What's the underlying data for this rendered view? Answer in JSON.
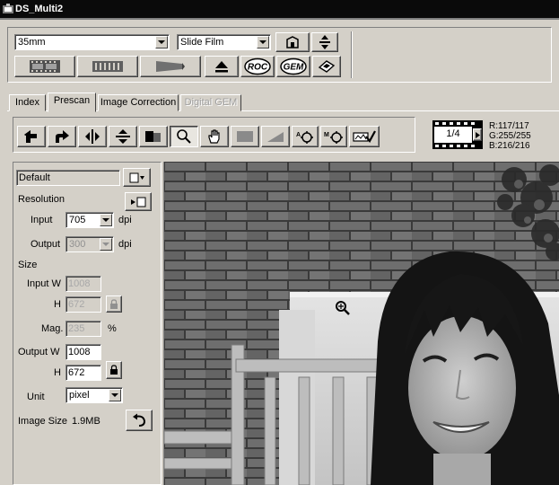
{
  "window": {
    "title": "DS_Multi2"
  },
  "toolbar": {
    "film_size": "35mm",
    "film_type": "Slide Film",
    "icons": [
      "film-strip-icon",
      "film-holder-icon",
      "slide-mount-icon",
      "eject-icon",
      "roc-icon",
      "gem-icon",
      "book-icon",
      "preferences-icon",
      "scan-adjust-icon"
    ],
    "roc_label": "ROC",
    "gem_label": "GEM"
  },
  "tabs": [
    {
      "label": "Index",
      "state": "normal"
    },
    {
      "label": "Prescan",
      "state": "active"
    },
    {
      "label": "Image Correction",
      "state": "normal"
    },
    {
      "label": "Digital GEM",
      "state": "disabled"
    }
  ],
  "tools": {
    "icons": [
      "rotate-left-icon",
      "rotate-right-icon",
      "flip-horizontal-icon",
      "flip-vertical-icon",
      "crop-icon",
      "zoom-icon",
      "hand-icon",
      "gray-swatch-icon",
      "gradient-icon",
      "white-point-icon",
      "midtone-point-icon",
      "apply-icon"
    ],
    "frame_counter": "1/4"
  },
  "rgb": {
    "r": "R:117/117",
    "g": "G:255/255",
    "b": "B:216/216"
  },
  "settings": {
    "preset": "Default",
    "resolution_label": "Resolution",
    "input_label": "Input",
    "input_value": "705",
    "input_unit": "dpi",
    "output_label": "Output",
    "output_value": "300",
    "output_unit": "dpi",
    "size_label": "Size",
    "input_w_label": "Input W",
    "input_w_value": "1008",
    "input_h_label": "H",
    "input_h_value": "672",
    "mag_label": "Mag.",
    "mag_value": "235",
    "mag_unit": "%",
    "output_w_label": "Output W",
    "output_w_value": "1008",
    "output_h_label": "H",
    "output_h_value": "672",
    "unit_label": "Unit",
    "unit_value": "pixel",
    "image_size_label": "Image Size",
    "image_size_value": "1.9MB"
  },
  "colors": {
    "titlebar": "#0a0a0a",
    "face": "#d4d0c8"
  }
}
